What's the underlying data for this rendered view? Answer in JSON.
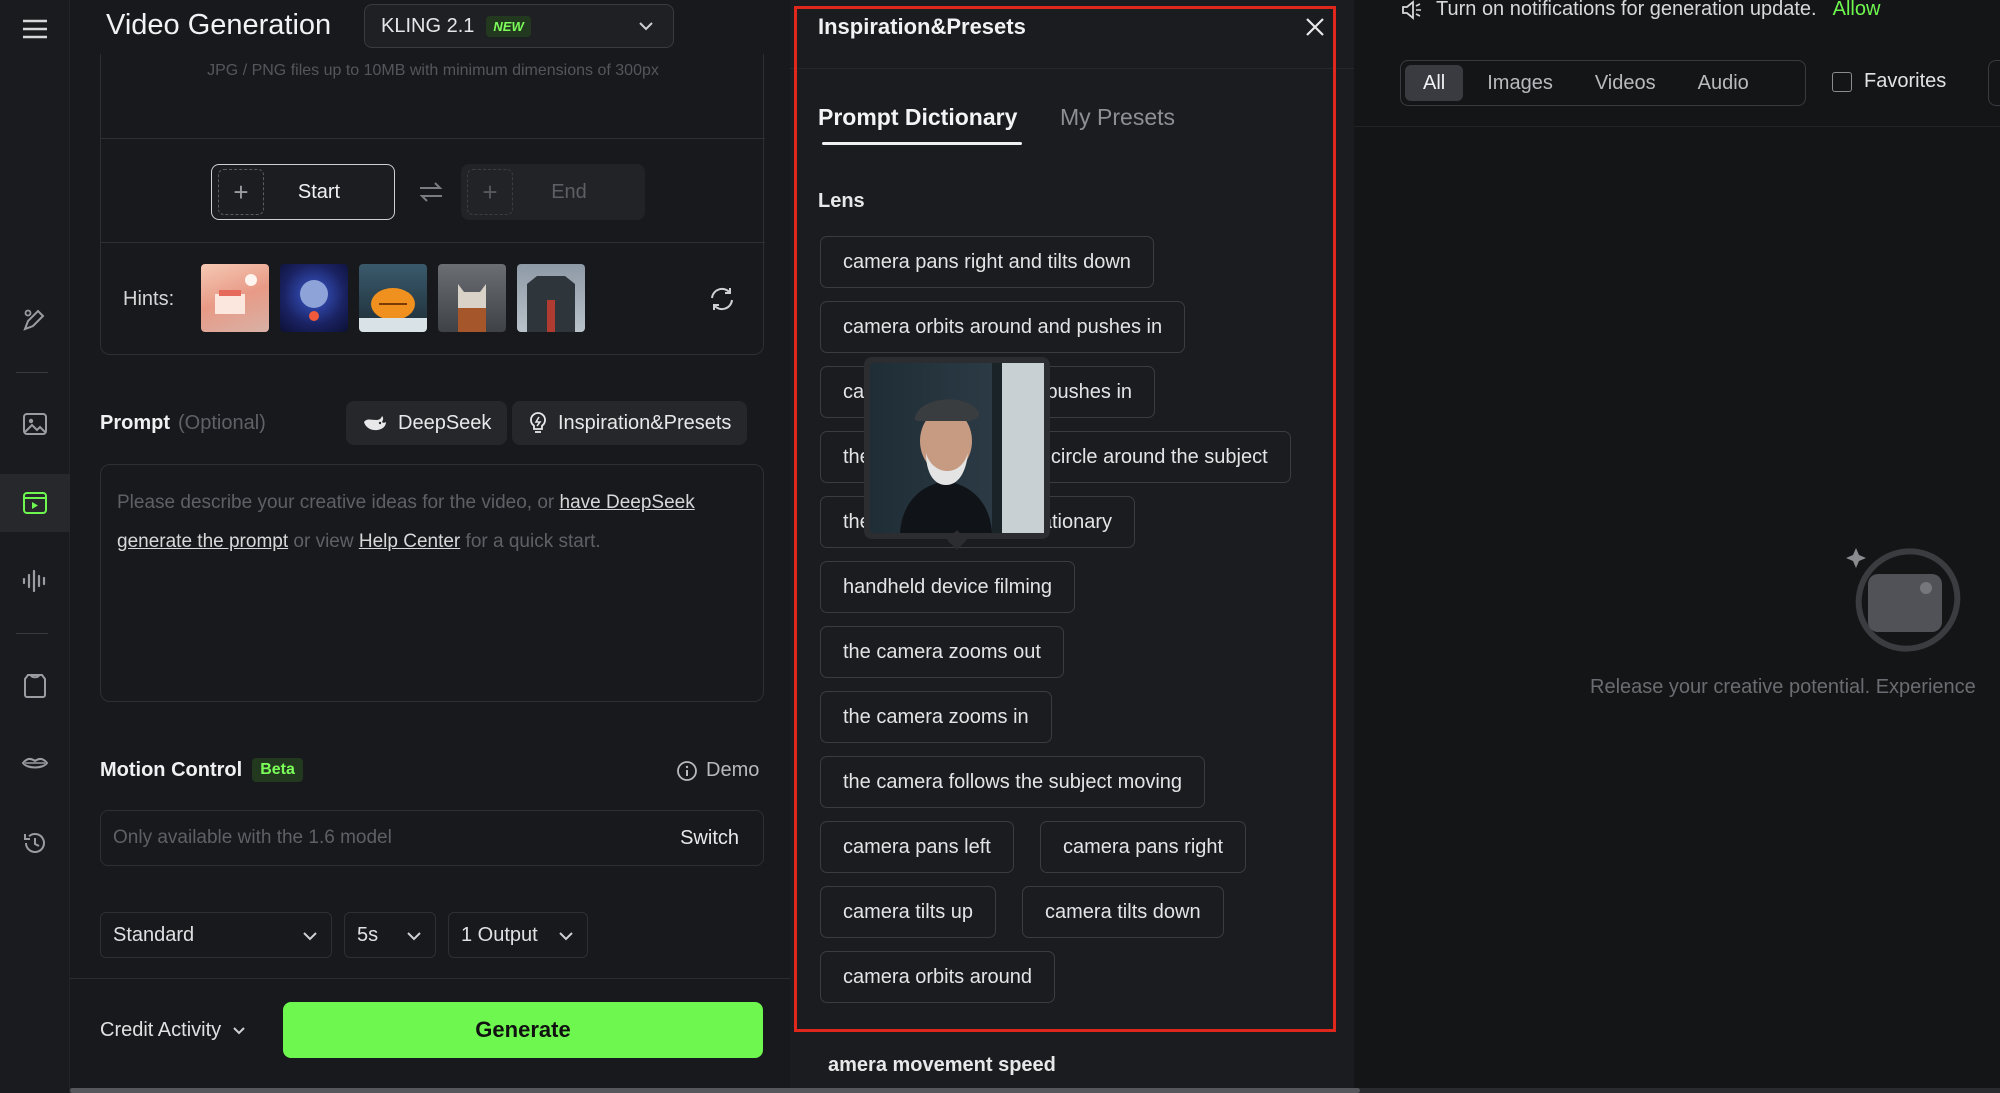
{
  "header": {
    "title": "Video Generation",
    "model": "KLING 2.1",
    "model_badge": "NEW"
  },
  "upload": {
    "hint": "JPG / PNG files up to 10MB with minimum dimensions of 300px",
    "start_label": "Start",
    "end_label": "End",
    "hints_label": "Hints:"
  },
  "prompt": {
    "label": "Prompt",
    "optional": "(Optional)",
    "deepseek_label": "DeepSeek",
    "presets_label": "Inspiration&Presets",
    "placeholder_pre": "Please describe your creative ideas for the video, or ",
    "link_deepseek": "have DeepSeek generate the prompt",
    "placeholder_mid": " or view ",
    "link_help": "Help Center",
    "placeholder_post": " for a quick start."
  },
  "motion": {
    "label": "Motion Control",
    "badge": "Beta",
    "demo_label": "Demo",
    "field_text": "Only available with the 1.6 model",
    "switch_label": "Switch"
  },
  "settings": {
    "mode": "Standard",
    "duration": "5s",
    "outputs": "1 Output"
  },
  "footer": {
    "credit_label": "Credit Activity",
    "generate_label": "Generate"
  },
  "panel": {
    "title": "Inspiration&Presets",
    "tabs": [
      {
        "label": "Prompt Dictionary",
        "active": true
      },
      {
        "label": "My Presets",
        "active": false
      }
    ],
    "section_title": "Lens",
    "chips": [
      "camera pans right and tilts down",
      "camera orbits around and pushes in",
      "camera moves up and pushes in",
      "the camera moves in a circle around the subject",
      "the camera remains stationary",
      "handheld device filming",
      "the camera zooms out",
      "the camera zooms in",
      "the camera follows the subject moving",
      "camera pans left",
      "camera pans right",
      "camera tilts up",
      "camera tilts down",
      "camera orbits around"
    ],
    "next_section": "amera movement speed"
  },
  "right": {
    "notification": "Turn on notifications for generation update.",
    "allow_label": "Allow",
    "filters": [
      "All",
      "Images",
      "Videos",
      "Audio"
    ],
    "active_filter": "All",
    "favorites_label": "Favorites",
    "empty_text": "Release your creative potential. Experience"
  },
  "colors": {
    "accent": "#6ef84f",
    "highlight_border": "#e0271b"
  }
}
